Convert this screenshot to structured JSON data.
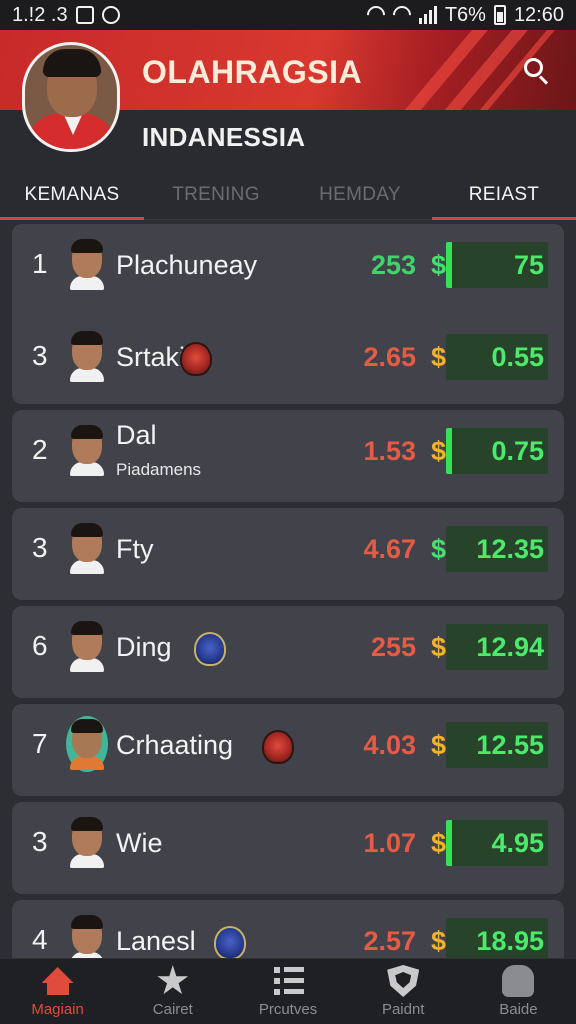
{
  "status_bar": {
    "left_text": "1.!2 .3",
    "battery_text": "T6%",
    "time": "12:60"
  },
  "header": {
    "title": "OLAHRAGSIA",
    "subtitle": "INDANESSIA"
  },
  "tabs": [
    {
      "label": "KEMANAS",
      "active": true
    },
    {
      "label": "TRENING",
      "active": false
    },
    {
      "label": "HEMDAY",
      "active": false
    },
    {
      "label": "REIAST",
      "active": true
    }
  ],
  "players": [
    {
      "rank": "1",
      "name": "Plachuneay",
      "sub": "",
      "price": "253",
      "price_color": "green",
      "dollar_color": "green",
      "value": "75",
      "has_bar": true,
      "crest": ""
    },
    {
      "rank": "3",
      "name": "Srtakiu",
      "sub": "",
      "price": "2.65",
      "price_color": "red",
      "dollar_color": "yellow",
      "value": "0.55",
      "has_bar": false,
      "crest": "red"
    },
    {
      "rank": "2",
      "name": "Dal",
      "sub": "Piadamens",
      "price": "1.53",
      "price_color": "red",
      "dollar_color": "yellow",
      "value": "0.75",
      "has_bar": true,
      "crest": ""
    },
    {
      "rank": "3",
      "name": "Fty",
      "sub": "",
      "price": "4.67",
      "price_color": "red",
      "dollar_color": "green",
      "value": "12.35",
      "has_bar": false,
      "crest": ""
    },
    {
      "rank": "6",
      "name": "Ding",
      "sub": "",
      "price": "255",
      "price_color": "red",
      "dollar_color": "yellow",
      "value": "12.94",
      "has_bar": false,
      "crest": "blue"
    },
    {
      "rank": "7",
      "name": "Crhaating",
      "sub": "",
      "price": "4.03",
      "price_color": "red",
      "dollar_color": "yellow",
      "value": "12.55",
      "has_bar": false,
      "crest": "red"
    },
    {
      "rank": "3",
      "name": "Wie",
      "sub": "",
      "price": "1.07",
      "price_color": "red",
      "dollar_color": "yellow",
      "value": "4.95",
      "has_bar": true,
      "crest": ""
    },
    {
      "rank": "4",
      "name": "Lanesl",
      "sub": "",
      "price": "2.57",
      "price_color": "red",
      "dollar_color": "yellow",
      "value": "18.95",
      "has_bar": false,
      "crest": "blue"
    }
  ],
  "currency_symbol": "$",
  "bottom_nav": [
    {
      "label": "Magiain",
      "icon": "home-icon",
      "active": true
    },
    {
      "label": "Cairet",
      "icon": "star-icon",
      "active": false
    },
    {
      "label": "Prcutves",
      "icon": "list-icon",
      "active": false
    },
    {
      "label": "Paidnt",
      "icon": "shield-icon",
      "active": false
    },
    {
      "label": "Baide",
      "icon": "puzzle-icon",
      "active": false
    }
  ]
}
